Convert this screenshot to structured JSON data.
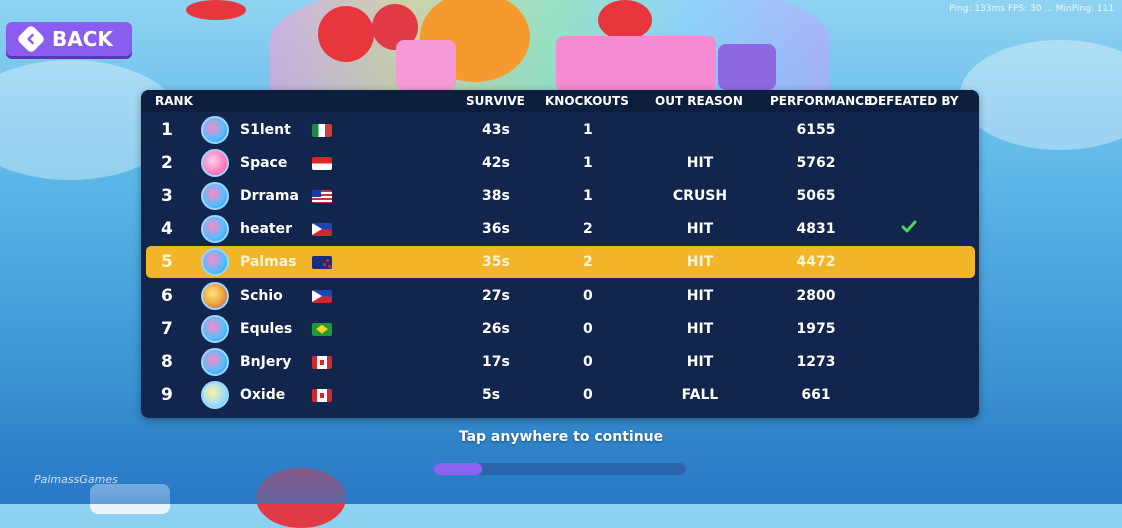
{
  "hud": {
    "stats": "Ping: 133ms  FPS: 30  ...  MinPing: 111"
  },
  "back_button": {
    "label": "BACK"
  },
  "table": {
    "headers": {
      "rank": "RANK",
      "survive": "SURVIVE",
      "knockouts": "KNOCKOUTS",
      "out_reason": "OUT REASON",
      "performance": "PERFORMANCE",
      "defeated_by": "DEFEATED BY"
    },
    "rows": [
      {
        "rank": "1",
        "name": "S1lent",
        "flag": "mexico-flag",
        "survive": "43s",
        "knockouts": "1",
        "out_reason": "",
        "performance": "6155",
        "defeated_by": false,
        "highlight": false
      },
      {
        "rank": "2",
        "name": "Space",
        "flag": "indonesia-flag",
        "survive": "42s",
        "knockouts": "1",
        "out_reason": "HIT",
        "performance": "5762",
        "defeated_by": false,
        "highlight": false
      },
      {
        "rank": "3",
        "name": "Drrama",
        "flag": "malaysia-flag",
        "survive": "38s",
        "knockouts": "1",
        "out_reason": "CRUSH",
        "performance": "5065",
        "defeated_by": false,
        "highlight": false
      },
      {
        "rank": "4",
        "name": "heater",
        "flag": "philippines-flag",
        "survive": "36s",
        "knockouts": "2",
        "out_reason": "HIT",
        "performance": "4831",
        "defeated_by": true,
        "highlight": false
      },
      {
        "rank": "5",
        "name": "Palmas",
        "flag": "new-zealand-flag",
        "survive": "35s",
        "knockouts": "2",
        "out_reason": "HIT",
        "performance": "4472",
        "defeated_by": false,
        "highlight": true
      },
      {
        "rank": "6",
        "name": "Schio",
        "flag": "philippines-flag",
        "survive": "27s",
        "knockouts": "0",
        "out_reason": "HIT",
        "performance": "2800",
        "defeated_by": false,
        "highlight": false
      },
      {
        "rank": "7",
        "name": "Equles",
        "flag": "brazil-flag",
        "survive": "26s",
        "knockouts": "0",
        "out_reason": "HIT",
        "performance": "1975",
        "defeated_by": false,
        "highlight": false
      },
      {
        "rank": "8",
        "name": "BnJery",
        "flag": "canada-flag",
        "survive": "17s",
        "knockouts": "0",
        "out_reason": "HIT",
        "performance": "1273",
        "defeated_by": false,
        "highlight": false
      },
      {
        "rank": "9",
        "name": "Oxide",
        "flag": "canada-flag",
        "survive": "5s",
        "knockouts": "0",
        "out_reason": "FALL",
        "performance": "661",
        "defeated_by": false,
        "highlight": false
      }
    ]
  },
  "continue_prompt": "Tap anywhere to continue",
  "progress": {
    "fraction": 0.19
  },
  "watermark": "PalmassGames",
  "colors": {
    "panel": "#12264d",
    "highlight": "#f2b429",
    "accent": "#8b5cf0",
    "check": "#4bd65a"
  }
}
